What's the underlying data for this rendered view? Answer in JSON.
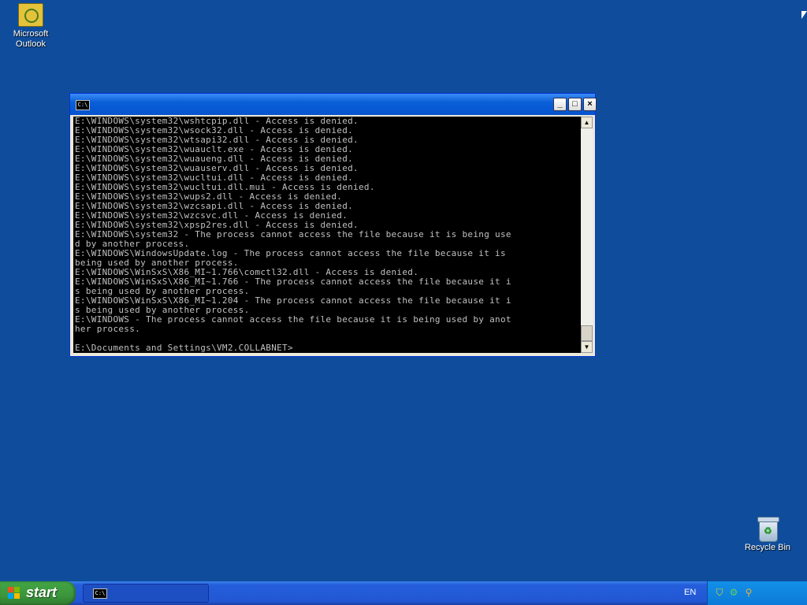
{
  "desktop": {
    "icons": [
      {
        "label_line1": "Microsoft",
        "label_line2": "Outlook",
        "icon": "outlook-icon"
      },
      {
        "label_line1": "Recycle Bin",
        "label_line2": "",
        "icon": "recycle-bin-icon"
      }
    ],
    "background_color": "#0f4d9c"
  },
  "console": {
    "icon_text": "C:\\",
    "buttons": {
      "minimize": "_",
      "maximize": "□",
      "close": "×"
    },
    "scroll_up": "▲",
    "scroll_down": "▼",
    "lines": [
      "E:\\WINDOWS\\system32\\wshtcpip.dll - Access is denied.",
      "E:\\WINDOWS\\system32\\wsock32.dll - Access is denied.",
      "E:\\WINDOWS\\system32\\wtsapi32.dll - Access is denied.",
      "E:\\WINDOWS\\system32\\wuauclt.exe - Access is denied.",
      "E:\\WINDOWS\\system32\\wuaueng.dll - Access is denied.",
      "E:\\WINDOWS\\system32\\wuauserv.dll - Access is denied.",
      "E:\\WINDOWS\\system32\\wucltui.dll - Access is denied.",
      "E:\\WINDOWS\\system32\\wucltui.dll.mui - Access is denied.",
      "E:\\WINDOWS\\system32\\wups2.dll - Access is denied.",
      "E:\\WINDOWS\\system32\\wzcsapi.dll - Access is denied.",
      "E:\\WINDOWS\\system32\\wzcsvc.dll - Access is denied.",
      "E:\\WINDOWS\\system32\\xpsp2res.dll - Access is denied.",
      "E:\\WINDOWS\\system32 - The process cannot access the file because it is being use",
      "d by another process.",
      "E:\\WINDOWS\\WindowsUpdate.log - The process cannot access the file because it is",
      "being used by another process.",
      "E:\\WINDOWS\\WinSxS\\X86_MI~1.766\\comctl32.dll - Access is denied.",
      "E:\\WINDOWS\\WinSxS\\X86_MI~1.766 - The process cannot access the file because it i",
      "s being used by another process.",
      "E:\\WINDOWS\\WinSxS\\X86_MI~1.204 - The process cannot access the file because it i",
      "s being used by another process.",
      "E:\\WINDOWS - The process cannot access the file because it is being used by anot",
      "her process.",
      "",
      "E:\\Documents and Settings\\VM2.COLLABNET>"
    ]
  },
  "taskbar": {
    "start_label": "start",
    "task_icon_text": "C:\\",
    "language": "EN"
  },
  "colors": {
    "console_text": "#c0c0c0",
    "titlebar_blue": "#0a5fd7",
    "start_green": "#3c963c",
    "tray_blue": "#0c7ad8"
  }
}
